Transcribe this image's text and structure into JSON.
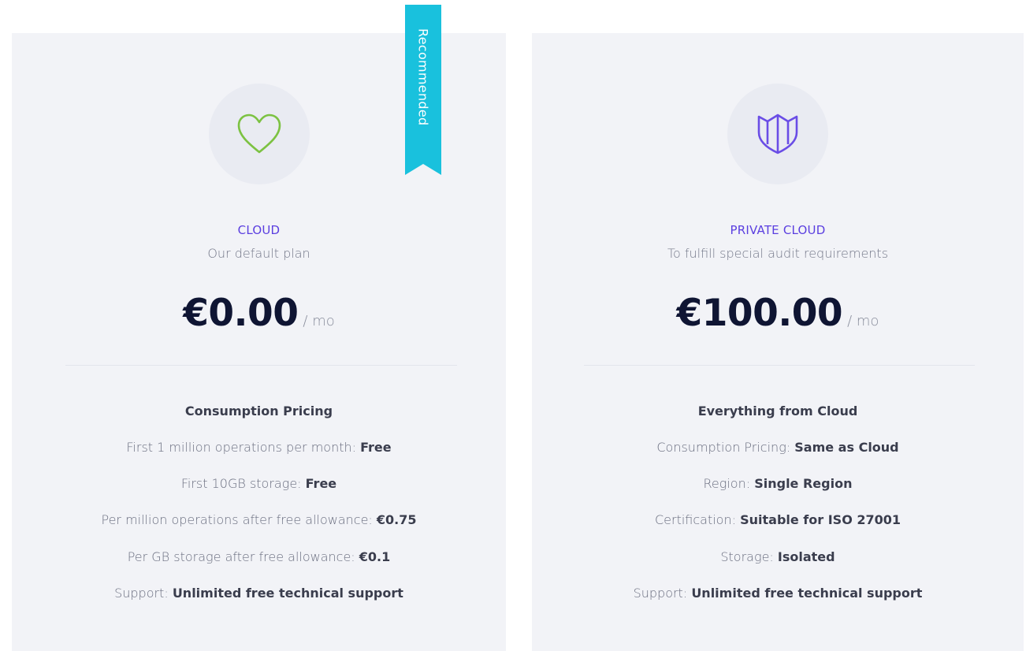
{
  "ribbon": {
    "label": "Recommended"
  },
  "plans": [
    {
      "name": "CLOUD",
      "description": "Our default plan",
      "price": "€0.00",
      "period": "/ mo",
      "icon": "heart-icon",
      "icon_color": "#7cc242",
      "features_title": "Consumption Pricing",
      "features": [
        {
          "label": "First 1 million operations per month: ",
          "value": "Free"
        },
        {
          "label": "First 10GB storage: ",
          "value": "Free"
        },
        {
          "label": "Per million operations after free allowance: ",
          "value": "€0.75"
        },
        {
          "label": "Per GB storage after free allowance: ",
          "value": "€0.1"
        },
        {
          "label": "Support: ",
          "value": "Unlimited free technical support"
        }
      ]
    },
    {
      "name": "PRIVATE CLOUD",
      "description": "To fulfill special audit requirements",
      "price": "€100.00",
      "period": "/ mo",
      "icon": "shield-icon",
      "icon_color": "#6a4de6",
      "features_title": "Everything from Cloud",
      "features": [
        {
          "label": "Consumption Pricing: ",
          "value": "Same as Cloud"
        },
        {
          "label": "Region: ",
          "value": "Single Region"
        },
        {
          "label": "Certification: ",
          "value": "Suitable for ISO 27001"
        },
        {
          "label": "Storage: ",
          "value": "Isolated"
        },
        {
          "label": "Support: ",
          "value": "Unlimited free technical support"
        }
      ]
    }
  ],
  "colors": {
    "accent": "#5b3fe0",
    "ribbon": "#19c1dd",
    "card_bg": "#f2f3f7",
    "price_text": "#0f1533"
  }
}
